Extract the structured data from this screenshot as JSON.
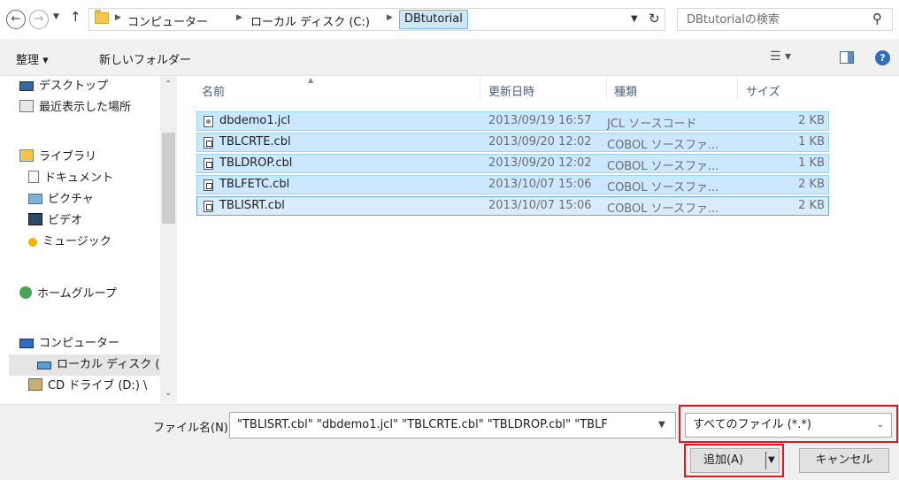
{
  "address_bar": {
    "breadcrumbs": [
      "コンピューター",
      "ローカル ディスク (C:)"
    ],
    "current_folder": "DBtutorial",
    "search_placeholder": "DBtutorialの検索"
  },
  "toolbar": {
    "organize_label": "整理 ▾",
    "new_folder_label": "新しいフォルダー"
  },
  "sidebar": {
    "items": [
      {
        "label": "デスクトップ",
        "icon": "desktop-icon"
      },
      {
        "label": "最近表示した場所",
        "icon": "recent-places-icon"
      },
      {
        "label": "ライブラリ",
        "icon": "library-icon"
      },
      {
        "label": "ドキュメント",
        "icon": "documents-icon"
      },
      {
        "label": "ピクチャ",
        "icon": "pictures-icon"
      },
      {
        "label": "ビデオ",
        "icon": "videos-icon"
      },
      {
        "label": "ミュージック",
        "icon": "music-icon"
      },
      {
        "label": "ホームグループ",
        "icon": "homegroup-icon"
      },
      {
        "label": "コンピューター",
        "icon": "computer-icon"
      },
      {
        "label": "ローカル ディスク (C",
        "icon": "local-disk-icon"
      },
      {
        "label": "CD ドライブ (D:) \\",
        "icon": "cd-drive-icon"
      }
    ]
  },
  "file_list": {
    "columns": [
      "名前",
      "更新日時",
      "種類",
      "サイズ"
    ],
    "files": [
      {
        "name": "dbdemo1.jcl",
        "date": "2013/09/19 16:57",
        "type": "JCL ソースコード",
        "size": "2 KB"
      },
      {
        "name": "TBLCRTE.cbl",
        "date": "2013/09/20 12:02",
        "type": "COBOL ソースファ...",
        "size": "1 KB"
      },
      {
        "name": "TBLDROP.cbl",
        "date": "2013/09/20 12:02",
        "type": "COBOL ソースファ...",
        "size": "1 KB"
      },
      {
        "name": "TBLFETC.cbl",
        "date": "2013/10/07 15:06",
        "type": "COBOL ソースファ...",
        "size": "2 KB"
      },
      {
        "name": "TBLISRT.cbl",
        "date": "2013/10/07 15:06",
        "type": "COBOL ソースファ...",
        "size": "2 KB"
      }
    ]
  },
  "footer": {
    "filename_label": "ファイル名(N):",
    "filename_value": "\"TBLISRT.cbl\" \"dbdemo1.jcl\" \"TBLCRTE.cbl\" \"TBLDROP.cbl\" \"TBLF",
    "filter_value": "すべてのファイル (*.*)",
    "add_label": "追加(A)",
    "cancel_label": "キャンセル"
  },
  "colors": {
    "highlight": "#e0191e",
    "selection": "#cce8ff",
    "selection_border": "#99d1ff"
  }
}
